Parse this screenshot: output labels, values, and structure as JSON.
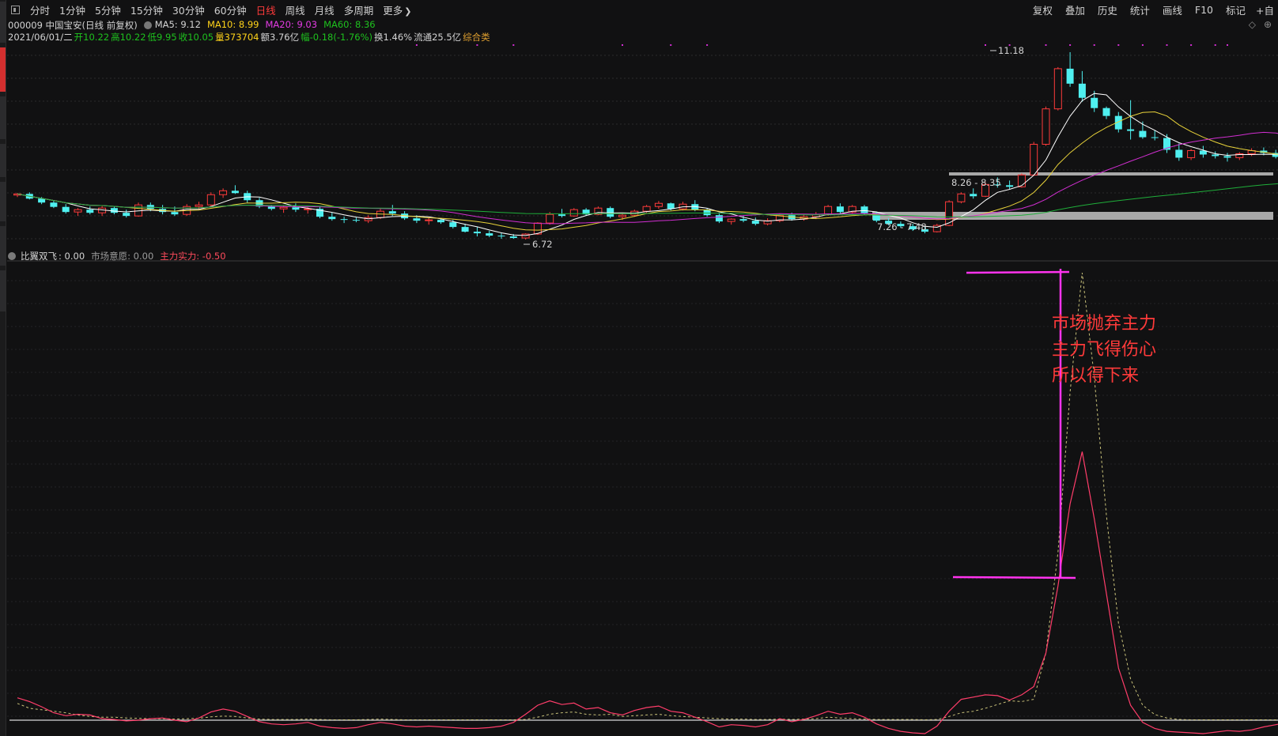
{
  "toolbar": {
    "periods": [
      {
        "label": "分时",
        "active": false
      },
      {
        "label": "1分钟",
        "active": false
      },
      {
        "label": "5分钟",
        "active": false
      },
      {
        "label": "15分钟",
        "active": false
      },
      {
        "label": "30分钟",
        "active": false
      },
      {
        "label": "60分钟",
        "active": false
      },
      {
        "label": "日线",
        "active": true
      },
      {
        "label": "周线",
        "active": false
      },
      {
        "label": "月线",
        "active": false
      },
      {
        "label": "多周期",
        "active": false
      },
      {
        "label": "更多",
        "active": false
      }
    ],
    "right_tools": [
      "复权",
      "叠加",
      "历史",
      "统计",
      "画线",
      "F10",
      "标记",
      "+自"
    ]
  },
  "stock": {
    "title": "000009 中国宝安(日线 前复权)",
    "ma5": "MA5: 9.12",
    "ma10": "MA10: 8.99",
    "ma20": "MA20: 9.03",
    "ma60": "MA60: 8.36",
    "date": "2021/06/01/二",
    "open": "开10.22",
    "high": "高10.22",
    "low": "低9.95",
    "close": "收10.05",
    "volume": "量373704",
    "amount": "额3.76亿",
    "change": "幅-0.18(-1.76%)",
    "turnover": "换1.46%",
    "float": "流通25.5亿",
    "category": "综合类"
  },
  "price_labels": {
    "high_mark": "11.18",
    "low_mark": "6.72",
    "zone_upper": "8.26 - 8.35",
    "zone_lower": "7.26 - 7.48"
  },
  "indicator": {
    "name": "比翼双飞",
    "value": ": 0.00",
    "market_will": "市场意愿: 0.00",
    "main_force": "主力实力: -0.50"
  },
  "annotation": {
    "line1": "市场抛弃主力",
    "line2": "主力飞得伤心",
    "line3": "所以得下来"
  },
  "colors": {
    "up": "#ff3b3b",
    "down": "#4ff0f0",
    "ma5": "#ffffff",
    "ma10": "#e8d23a",
    "ma20": "#d12ed1",
    "ma60": "#1fae3a",
    "annotation": "#ff3a3a",
    "bracket": "#ff33ee"
  },
  "chart_data": {
    "type": "candlestick",
    "candles": [
      [
        7.55,
        7.6,
        7.5,
        7.58
      ],
      [
        7.58,
        7.62,
        7.44,
        7.46
      ],
      [
        7.46,
        7.5,
        7.32,
        7.36
      ],
      [
        7.36,
        7.42,
        7.22,
        7.25
      ],
      [
        7.25,
        7.32,
        7.08,
        7.12
      ],
      [
        7.12,
        7.22,
        7.02,
        7.18
      ],
      [
        7.18,
        7.26,
        7.06,
        7.1
      ],
      [
        7.1,
        7.28,
        7.02,
        7.22
      ],
      [
        7.22,
        7.26,
        7.06,
        7.1
      ],
      [
        7.1,
        7.18,
        6.98,
        7.02
      ],
      [
        7.02,
        7.36,
        7.0,
        7.3
      ],
      [
        7.3,
        7.36,
        7.14,
        7.2
      ],
      [
        7.2,
        7.3,
        7.06,
        7.12
      ],
      [
        7.12,
        7.26,
        7.02,
        7.06
      ],
      [
        7.06,
        7.32,
        7.02,
        7.26
      ],
      [
        7.26,
        7.38,
        7.18,
        7.3
      ],
      [
        7.3,
        7.62,
        7.24,
        7.56
      ],
      [
        7.56,
        7.72,
        7.48,
        7.66
      ],
      [
        7.66,
        7.8,
        7.58,
        7.6
      ],
      [
        7.6,
        7.66,
        7.36,
        7.42
      ],
      [
        7.42,
        7.48,
        7.22,
        7.26
      ],
      [
        7.26,
        7.3,
        7.16,
        7.2
      ],
      [
        7.2,
        7.28,
        7.1,
        7.24
      ],
      [
        7.24,
        7.34,
        7.12,
        7.18
      ],
      [
        7.18,
        7.24,
        7.08,
        7.2
      ],
      [
        7.2,
        7.26,
        6.96,
        7.0
      ],
      [
        7.0,
        7.1,
        6.9,
        6.94
      ],
      [
        6.94,
        7.0,
        6.84,
        6.92
      ],
      [
        6.92,
        6.98,
        6.86,
        6.9
      ],
      [
        6.9,
        7.04,
        6.84,
        6.98
      ],
      [
        6.98,
        7.2,
        6.94,
        7.14
      ],
      [
        7.14,
        7.3,
        7.02,
        7.08
      ],
      [
        7.08,
        7.14,
        6.92,
        6.96
      ],
      [
        6.96,
        7.04,
        6.84,
        6.9
      ],
      [
        6.9,
        6.98,
        6.8,
        6.92
      ],
      [
        6.92,
        6.96,
        6.82,
        6.86
      ],
      [
        6.86,
        6.92,
        6.7,
        6.74
      ],
      [
        6.74,
        6.82,
        6.6,
        6.62
      ],
      [
        6.62,
        6.74,
        6.5,
        6.58
      ],
      [
        6.58,
        6.64,
        6.48,
        6.52
      ],
      [
        6.52,
        6.6,
        6.44,
        6.5
      ],
      [
        6.5,
        6.56,
        6.44,
        6.46
      ],
      [
        6.46,
        6.58,
        6.42,
        6.56
      ],
      [
        6.56,
        6.86,
        6.54,
        6.84
      ],
      [
        6.84,
        7.12,
        6.8,
        7.06
      ],
      [
        7.06,
        7.2,
        6.98,
        7.02
      ],
      [
        7.02,
        7.22,
        7.0,
        7.18
      ],
      [
        7.18,
        7.22,
        7.02,
        7.06
      ],
      [
        7.06,
        7.26,
        7.04,
        7.22
      ],
      [
        7.22,
        7.26,
        6.96,
        7.0
      ],
      [
        7.0,
        7.08,
        6.92,
        7.04
      ],
      [
        7.04,
        7.18,
        7.0,
        7.14
      ],
      [
        7.14,
        7.3,
        7.1,
        7.26
      ],
      [
        7.26,
        7.4,
        7.2,
        7.34
      ],
      [
        7.34,
        7.36,
        7.16,
        7.2
      ],
      [
        7.2,
        7.38,
        7.16,
        7.32
      ],
      [
        7.32,
        7.42,
        7.14,
        7.18
      ],
      [
        7.18,
        7.22,
        7.0,
        7.04
      ],
      [
        7.04,
        7.08,
        6.84,
        6.88
      ],
      [
        6.88,
        6.96,
        6.8,
        6.94
      ],
      [
        6.94,
        7.02,
        6.86,
        6.9
      ],
      [
        6.9,
        6.98,
        6.78,
        6.82
      ],
      [
        6.82,
        6.96,
        6.78,
        6.9
      ],
      [
        6.9,
        7.08,
        6.86,
        7.04
      ],
      [
        7.04,
        7.1,
        6.9,
        6.94
      ],
      [
        6.94,
        7.06,
        6.9,
        7.0
      ],
      [
        7.0,
        7.12,
        6.94,
        7.06
      ],
      [
        7.06,
        7.3,
        7.02,
        7.26
      ],
      [
        7.26,
        7.34,
        7.06,
        7.12
      ],
      [
        7.12,
        7.3,
        7.08,
        7.26
      ],
      [
        7.26,
        7.3,
        7.04,
        7.08
      ],
      [
        7.08,
        7.12,
        6.86,
        6.9
      ],
      [
        6.9,
        6.96,
        6.78,
        6.82
      ],
      [
        6.82,
        6.88,
        6.72,
        6.76
      ],
      [
        6.76,
        6.82,
        6.64,
        6.68
      ],
      [
        6.68,
        6.74,
        6.58,
        6.62
      ],
      [
        6.62,
        6.82,
        6.6,
        6.78
      ],
      [
        6.78,
        7.42,
        6.76,
        7.38
      ],
      [
        7.38,
        7.62,
        7.34,
        7.58
      ],
      [
        7.58,
        7.72,
        7.46,
        7.52
      ],
      [
        7.52,
        7.88,
        7.5,
        7.82
      ],
      [
        7.82,
        8.0,
        7.74,
        7.8
      ],
      [
        7.8,
        7.92,
        7.7,
        7.76
      ],
      [
        7.76,
        8.1,
        7.74,
        8.06
      ],
      [
        8.06,
        8.9,
        8.04,
        8.84
      ],
      [
        8.84,
        9.8,
        8.8,
        9.74
      ],
      [
        9.74,
        10.8,
        9.7,
        10.76
      ],
      [
        10.76,
        11.18,
        10.3,
        10.38
      ],
      [
        10.38,
        10.7,
        9.92,
        10.02
      ],
      [
        10.02,
        10.2,
        9.66,
        9.76
      ],
      [
        9.76,
        9.8,
        9.48,
        9.56
      ],
      [
        9.56,
        9.66,
        9.14,
        9.22
      ],
      [
        9.22,
        9.96,
        8.96,
        9.18
      ],
      [
        9.18,
        9.42,
        8.98,
        9.02
      ],
      [
        9.02,
        9.2,
        8.94,
        9.0
      ],
      [
        9.0,
        9.1,
        8.62,
        8.7
      ],
      [
        8.7,
        8.86,
        8.42,
        8.5
      ],
      [
        8.5,
        8.72,
        8.44,
        8.68
      ],
      [
        8.68,
        8.8,
        8.5,
        8.58
      ],
      [
        8.58,
        8.66,
        8.48,
        8.54
      ],
      [
        8.54,
        8.62,
        8.4,
        8.5
      ],
      [
        8.5,
        8.64,
        8.44,
        8.6
      ],
      [
        8.6,
        8.74,
        8.54,
        8.68
      ],
      [
        8.68,
        8.76,
        8.56,
        8.62
      ],
      [
        8.62,
        8.7,
        8.48,
        8.52
      ],
      [
        8.52,
        8.6,
        8.3,
        8.36
      ],
      [
        8.36,
        8.48,
        8.3,
        8.44
      ],
      [
        8.44,
        8.52,
        8.36,
        8.48
      ],
      [
        8.48,
        8.62,
        8.44,
        8.58
      ],
      [
        8.58,
        8.9,
        8.54,
        8.86
      ],
      [
        8.86,
        9.0,
        8.74,
        8.82
      ],
      [
        8.82,
        9.08,
        8.78,
        9.04
      ],
      [
        9.04,
        9.06,
        8.6,
        8.66
      ],
      [
        8.66,
        8.78,
        8.52,
        8.72
      ]
    ],
    "indicator_series": [
      {
        "name": "市场意愿",
        "values": [
          4.5,
          3.2,
          2.8,
          2.4,
          2.0,
          1.4,
          1.0,
          0.8,
          0.8,
          0.6,
          0.5,
          0.4,
          0.4,
          0.3,
          0.4,
          0.5,
          0.9,
          1.1,
          1.0,
          0.6,
          0.3,
          0.2,
          0.2,
          0.2,
          0.3,
          0.2,
          0.1,
          0.1,
          0.1,
          0.2,
          0.3,
          0.2,
          0.1,
          0.1,
          0.1,
          0.1,
          0.1,
          0.1,
          0.1,
          0.1,
          0.1,
          0.1,
          0.2,
          0.8,
          1.6,
          2.0,
          2.2,
          1.6,
          1.4,
          1.6,
          1.0,
          1.2,
          1.4,
          1.6,
          1.2,
          1.0,
          0.8,
          0.6,
          0.4,
          0.3,
          0.3,
          0.2,
          0.2,
          0.3,
          0.2,
          0.3,
          0.4,
          0.8,
          0.6,
          0.4,
          0.3,
          0.2,
          0.2,
          0.2,
          0.2,
          0.1,
          0.2,
          1.0,
          2.0,
          2.4,
          3.2,
          4.2,
          5.2,
          5.0,
          5.6,
          18.0,
          45.0,
          88.0,
          120.0,
          92.0,
          55.0,
          26.0,
          11.0,
          4.0,
          1.5,
          0.6,
          0.2,
          0.1,
          0.1,
          0.1,
          0.1,
          0.1,
          0.1,
          0.1,
          0.1,
          0.1,
          0.1,
          0.1,
          0.1,
          0.1,
          0.1,
          0.1,
          0.1,
          0.1,
          0.1,
          0.1
        ]
      },
      {
        "name": "主力实力",
        "values": [
          6.0,
          5.0,
          3.6,
          2.0,
          1.2,
          1.6,
          1.4,
          0.4,
          0.2,
          -0.2,
          0.0,
          0.4,
          0.6,
          0.0,
          -0.4,
          0.6,
          2.2,
          3.0,
          2.4,
          1.0,
          -0.4,
          -1.0,
          -1.2,
          -1.0,
          -0.6,
          -1.6,
          -2.0,
          -2.2,
          -2.0,
          -1.2,
          -0.6,
          -1.0,
          -1.6,
          -1.8,
          -1.6,
          -1.8,
          -2.0,
          -2.2,
          -2.2,
          -2.0,
          -1.6,
          -0.6,
          1.6,
          4.0,
          5.2,
          4.2,
          4.6,
          3.0,
          3.4,
          2.0,
          1.4,
          2.6,
          3.4,
          3.8,
          2.4,
          2.0,
          0.8,
          -0.4,
          -1.8,
          -1.2,
          -1.4,
          -1.8,
          -1.2,
          0.4,
          -0.4,
          0.2,
          1.2,
          2.4,
          1.6,
          2.0,
          0.8,
          -1.0,
          -2.2,
          -3.0,
          -3.4,
          -3.6,
          -1.6,
          2.4,
          5.6,
          6.2,
          6.8,
          6.6,
          5.4,
          6.8,
          9.0,
          18.0,
          36.0,
          58.0,
          72.0,
          54.0,
          34.0,
          14.0,
          4.0,
          -0.6,
          -2.2,
          -3.0,
          -3.2,
          -3.4,
          -3.6,
          -3.2,
          -2.8,
          -3.0,
          -2.6,
          -1.8,
          -1.2,
          -0.6,
          -0.8,
          -1.6,
          -2.0,
          -1.6,
          -0.4,
          0.6,
          -0.6,
          -1.8,
          -2.6,
          -3.0
        ]
      }
    ]
  }
}
